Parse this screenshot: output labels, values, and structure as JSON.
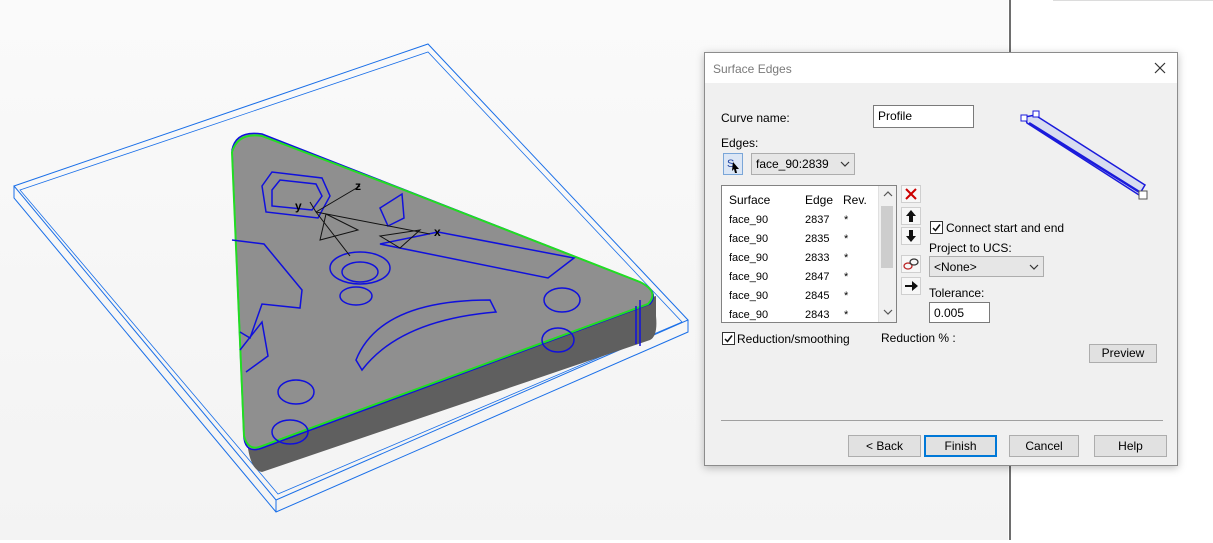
{
  "dialog": {
    "title": "Surface Edges",
    "curve_name_label": "Curve name:",
    "curve_name_value": "Profile",
    "edges_label": "Edges:",
    "edges_combo_value": "face_90:2839",
    "list": {
      "headers": [
        "Surface",
        "Edge",
        "Rev."
      ],
      "rows": [
        {
          "surface": "face_90",
          "edge": "2837",
          "rev": "*"
        },
        {
          "surface": "face_90",
          "edge": "2835",
          "rev": "*"
        },
        {
          "surface": "face_90",
          "edge": "2833",
          "rev": "*"
        },
        {
          "surface": "face_90",
          "edge": "2847",
          "rev": "*"
        },
        {
          "surface": "face_90",
          "edge": "2845",
          "rev": "*"
        },
        {
          "surface": "face_90",
          "edge": "2843",
          "rev": "*"
        }
      ]
    },
    "connect_label": "Connect start and end",
    "connect_checked": true,
    "project_label": "Project to UCS:",
    "project_value": "<None>",
    "tolerance_label": "Tolerance:",
    "tolerance_value": "0.005",
    "reduction_label": "Reduction/smoothing",
    "reduction_checked": true,
    "reduction_pct_label": "Reduction % :",
    "preview_label": "Preview",
    "buttons": {
      "back": "< Back",
      "finish": "Finish",
      "cancel": "Cancel",
      "help": "Help"
    },
    "icons": [
      "edge-select-icon",
      "delete-x-icon",
      "move-up-icon",
      "move-down-icon",
      "link-chain-icon",
      "arrow-right-icon"
    ]
  },
  "viewport": {
    "axis_labels": {
      "z": "z",
      "y": "y",
      "x": "x"
    },
    "colors": {
      "wireframe": "#1a6fe8",
      "edges": "#1010dd",
      "selection": "#22dd22",
      "part": "#8c8c8c"
    }
  }
}
